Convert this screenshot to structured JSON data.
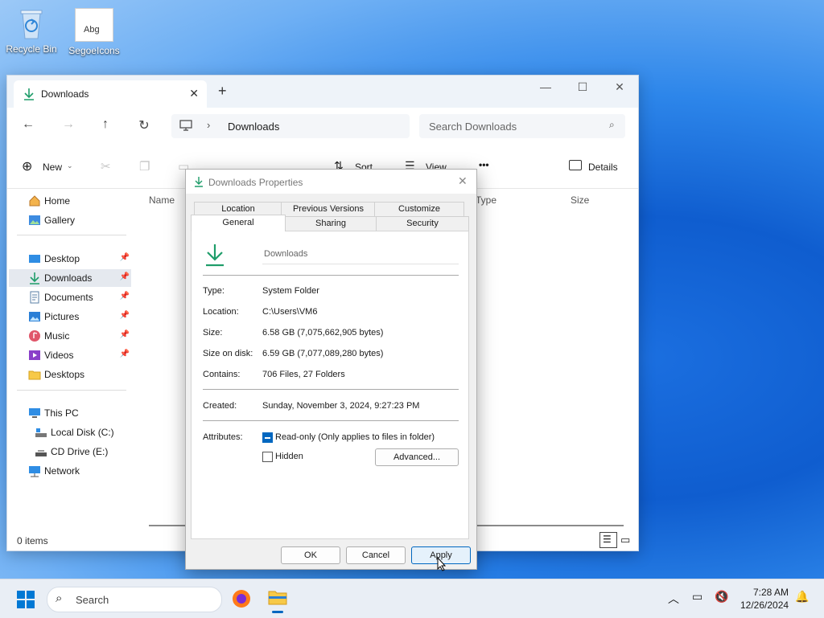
{
  "desktop": {
    "icons": [
      {
        "label": "Recycle Bin",
        "icon": "recycle-bin-icon"
      },
      {
        "label": "SegoeIcons",
        "icon": "font-file-icon",
        "glyph": "Abg"
      }
    ]
  },
  "explorer": {
    "tab_label": "Downloads",
    "address": "Downloads",
    "search_placeholder": "Search Downloads",
    "toolbar": {
      "new_label": "New",
      "sort_label": "Sort",
      "view_label": "View",
      "more_label": "•••",
      "details_label": "Details"
    },
    "columns": {
      "name": "Name",
      "type": "Type",
      "size": "Size"
    },
    "sidebar": {
      "items": [
        {
          "label": "Home",
          "pinned": false
        },
        {
          "label": "Gallery",
          "pinned": false
        },
        {
          "label": "Desktop",
          "pinned": true
        },
        {
          "label": "Downloads",
          "pinned": true,
          "selected": true
        },
        {
          "label": "Documents",
          "pinned": true
        },
        {
          "label": "Pictures",
          "pinned": true
        },
        {
          "label": "Music",
          "pinned": true
        },
        {
          "label": "Videos",
          "pinned": true
        },
        {
          "label": "Desktops",
          "pinned": false
        },
        {
          "label": "This PC",
          "pinned": false
        },
        {
          "label": "Local Disk (C:)",
          "pinned": false
        },
        {
          "label": "CD Drive (E:)",
          "pinned": false
        },
        {
          "label": "Network",
          "pinned": false
        }
      ]
    },
    "status": "0 items"
  },
  "dialog": {
    "title": "Downloads Properties",
    "tabs_back": [
      "Location",
      "Previous Versions",
      "Customize"
    ],
    "tabs_front": [
      "General",
      "Sharing",
      "Security"
    ],
    "folder_name": "Downloads",
    "fields": {
      "type_label": "Type:",
      "type_value": "System Folder",
      "location_label": "Location:",
      "location_value": "C:\\Users\\VM6",
      "size_label": "Size:",
      "size_value": "6.58 GB (7,075,662,905 bytes)",
      "disk_label": "Size on disk:",
      "disk_value": "6.59 GB (7,077,089,280 bytes)",
      "contains_label": "Contains:",
      "contains_value": "706 Files, 27 Folders",
      "created_label": "Created:",
      "created_value": "Sunday, November 3, 2024, 9:27:23 PM",
      "attributes_label": "Attributes:"
    },
    "readonly_label": "Read-only (Only applies to files in folder)",
    "hidden_label": "Hidden",
    "advanced_label": "Advanced...",
    "ok_label": "OK",
    "cancel_label": "Cancel",
    "apply_label": "Apply"
  },
  "taskbar": {
    "search_placeholder": "Search",
    "time": "7:28 AM",
    "date": "12/26/2024"
  },
  "colors": {
    "accent": "#0067c0",
    "download_green": "#1f9d6a"
  }
}
